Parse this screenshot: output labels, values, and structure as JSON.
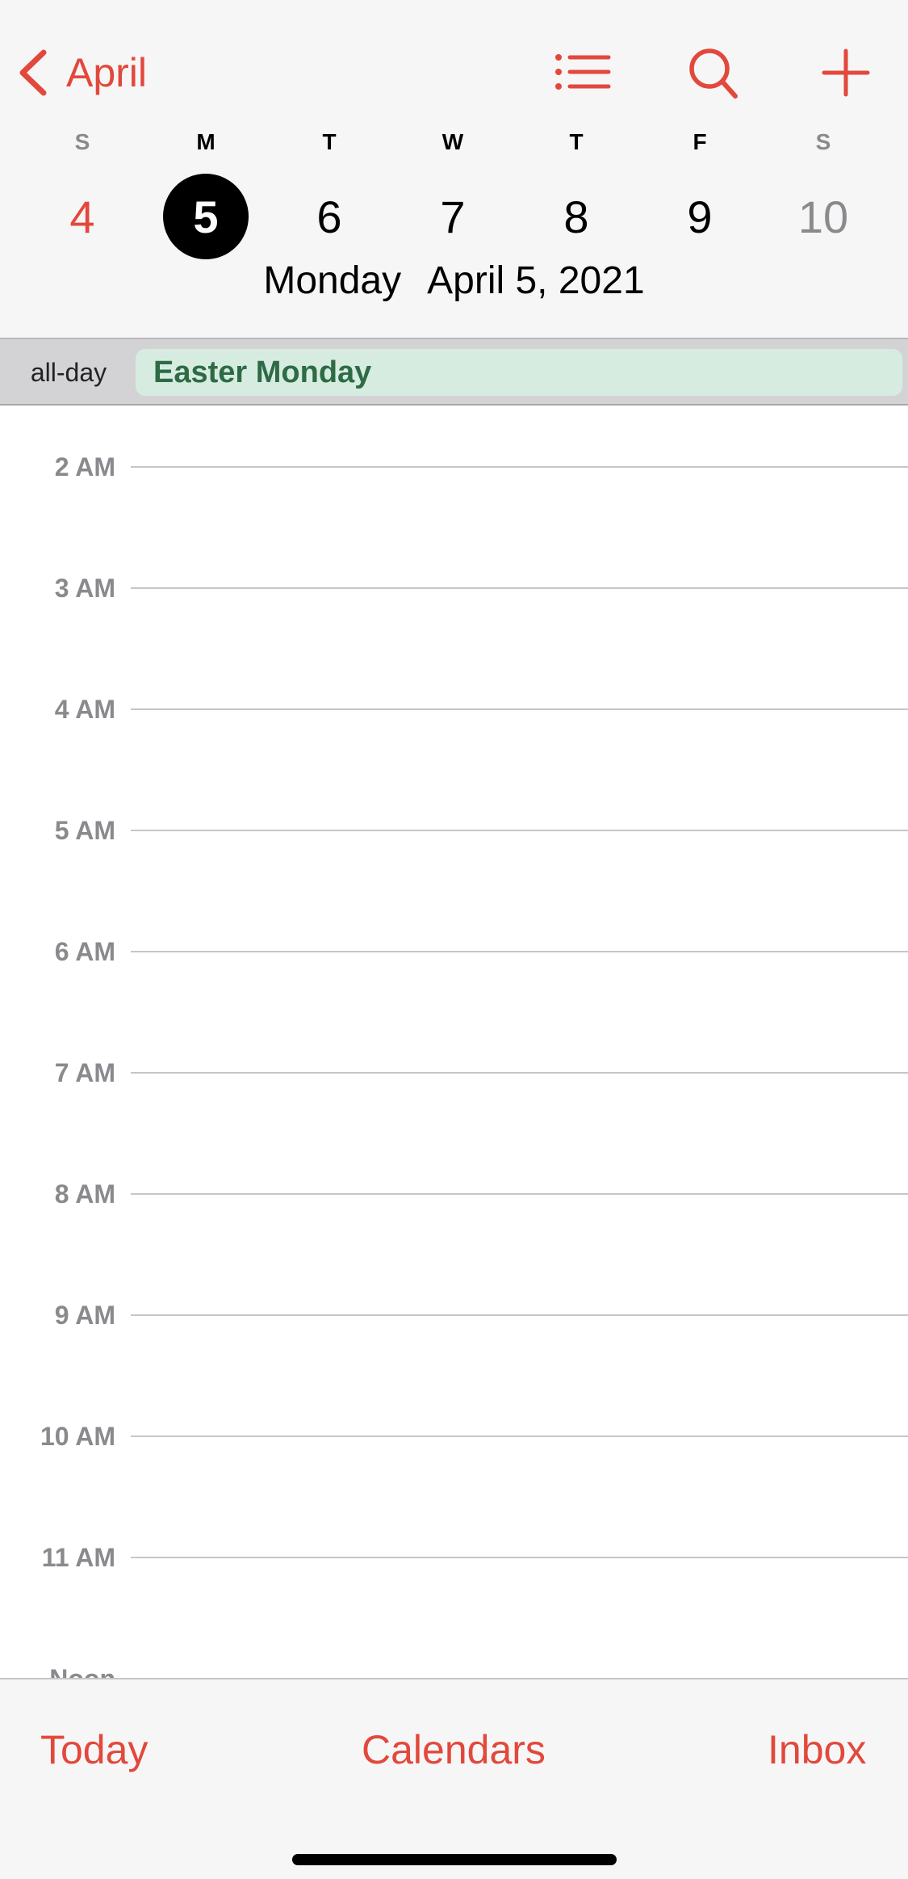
{
  "header": {
    "back_label": "April",
    "weekdays": [
      "S",
      "M",
      "T",
      "W",
      "T",
      "F",
      "S"
    ],
    "days": [
      "4",
      "5",
      "6",
      "7",
      "8",
      "9",
      "10"
    ],
    "selected_day": "5",
    "date_weekday": "Monday",
    "date_full": "April 5, 2021"
  },
  "allday": {
    "label": "all-day",
    "event": "Easter Monday"
  },
  "timeline": {
    "hours": [
      "2 AM",
      "3 AM",
      "4 AM",
      "5 AM",
      "6 AM",
      "7 AM",
      "8 AM",
      "9 AM",
      "10 AM",
      "11 AM",
      "Noon"
    ]
  },
  "bottom": {
    "today": "Today",
    "calendars": "Calendars",
    "inbox": "Inbox"
  },
  "colors": {
    "accent": "#e2483c",
    "event_bg": "#d6ece1",
    "event_text": "#2e6b45"
  },
  "icons": [
    "chevron-left-icon",
    "list-icon",
    "search-icon",
    "plus-icon"
  ]
}
